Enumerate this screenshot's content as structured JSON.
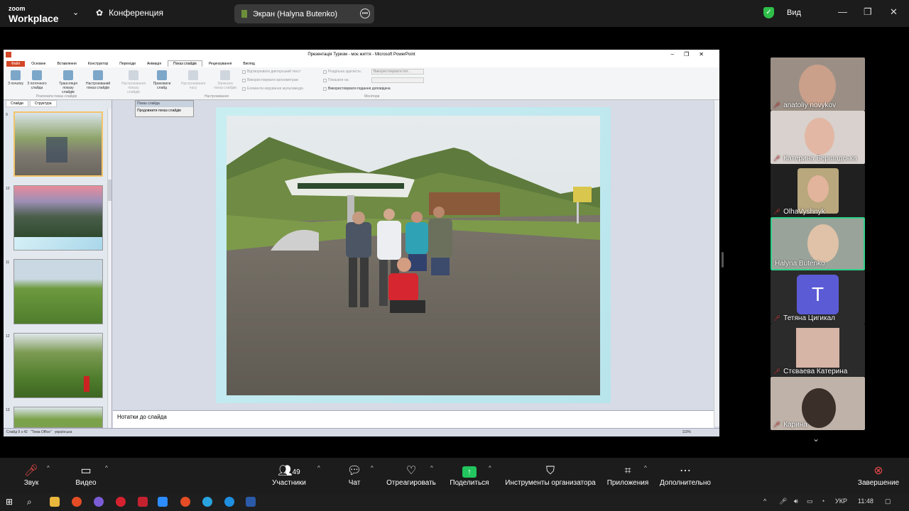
{
  "zoom": {
    "logo_line1": "zoom",
    "logo_line2": "Workplace",
    "meeting_label": "Конференция",
    "share_label": "Экран (Halyna Butenko)",
    "view_label": "Вид",
    "window_controls": [
      "—",
      "❐",
      "✕"
    ]
  },
  "ppt": {
    "window_title": "Презентація Туризм - моє життя - Microsoft PowerPoint",
    "tabs": [
      "Файл",
      "Основне",
      "Вставлення",
      "Конструктор",
      "Переходи",
      "Анімація",
      "Показ слайдів",
      "Рецензування",
      "Вигляд"
    ],
    "active_tab": "Показ слайдів",
    "ribbon_buttons": [
      "З початку",
      "З поточного слайда",
      "Трансляція показу слайдів",
      "Настроюваний показ слайдів",
      "Настроювання показу слайдів",
      "Приховати слайд",
      "Настроювання часу",
      "Записати показ слайдів"
    ],
    "ribbon_checks": [
      "Відтворювати дикторський текст",
      "Використовувати хронометраж",
      "Елементи керування мультимедіа"
    ],
    "monitor_rows": [
      "Роздільна здатність:",
      "Показати на:",
      "Використовувати подання доповідача"
    ],
    "resolution_value": "Використовувати пот...",
    "ribbon_groups": [
      "Розпочати показ слайдів",
      "Настроювання",
      "Монітори"
    ],
    "pane_tabs": [
      "Слайди",
      "Структура"
    ],
    "slide_numbers": [
      "9",
      "10",
      "11",
      "12",
      "13"
    ],
    "float_toolbar_title": "Показ слайда",
    "float_toolbar_button": "Продовжити показ слайдів",
    "notes_placeholder": "Нотатки до слайда",
    "status_slide": "Слайд 9 з 42",
    "status_theme": "\"Тема Office\"",
    "status_lang": "українська",
    "zoom_level": "110%"
  },
  "participants": [
    {
      "name": "anatoliy novykov",
      "muted": true
    },
    {
      "name": "Катерина Бершадська",
      "muted": true
    },
    {
      "name": "OlhaVyshnyk",
      "muted": true
    },
    {
      "name": "Halyna Butenko",
      "muted": false
    },
    {
      "name": "Тетяна Цигикал",
      "muted": true,
      "initial": "T"
    },
    {
      "name": "Стєваева Катерина",
      "muted": true
    },
    {
      "name": "Карина",
      "muted": true
    }
  ],
  "controls": {
    "audio": "Звук",
    "video": "Видео",
    "participants": "Участники",
    "participant_count": "49",
    "chat": "Чат",
    "react": "Отреагировать",
    "share": "Поделиться",
    "host_tools": "Инструменты организатора",
    "apps": "Приложения",
    "more": "Дополнительно",
    "end": "Завершение"
  },
  "taskbar": {
    "lang": "УКР",
    "time": "11:48"
  }
}
